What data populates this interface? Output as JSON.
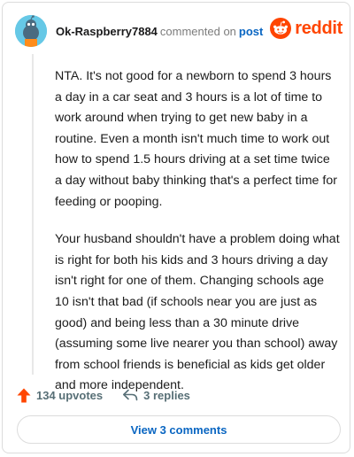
{
  "header": {
    "username": "Ok-Raspberry7884",
    "commented_text": "commented on",
    "post_link": "post",
    "brand": "reddit"
  },
  "comment": {
    "paragraphs": [
      "NTA. It's not good for a newborn to spend 3 hours a day in a car seat and 3 hours is a lot of time to work around when trying to get new baby in a routine. Even a month isn't much time to work out how to spend 1.5 hours driving at a set time twice a day without baby thinking that's a perfect time for feeding or pooping.",
      "Your husband shouldn't have a problem doing what is right for both his kids and 3 hours driving a day isn't right for one of them. Changing schools age 10 isn't that bad (if schools near you are just as good) and being less than a 30 minute drive (assuming some live nearer you than school) away from school friends is beneficial as kids get older and more independent."
    ]
  },
  "actions": {
    "upvotes": "134 upvotes",
    "replies": "3 replies"
  },
  "view_comments_label": "View 3 comments",
  "colors": {
    "brand": "#ff4500",
    "link": "#0a66c2",
    "avatar_bg": "#66c8e6"
  },
  "icons": {
    "upvote": "upvote-arrow-icon",
    "reply": "reply-arrow-icon",
    "brand": "reddit-snoo-icon",
    "avatar": "snoo-avatar-icon"
  }
}
